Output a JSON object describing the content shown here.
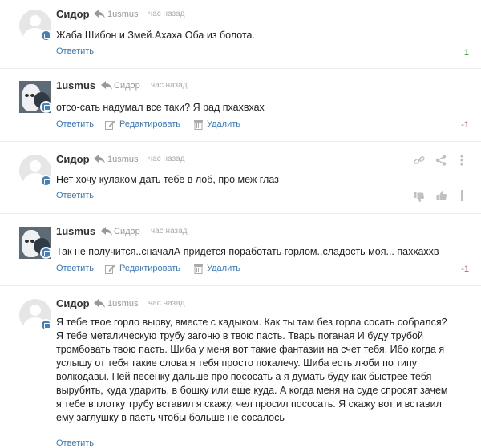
{
  "comments": [
    {
      "author": "Сидор",
      "reply_to": "1usmus",
      "time": "час назад",
      "text": "Жаба Шибон и Змей.Ахаха Оба из болота.",
      "reply_label": "Ответить",
      "rating": "1",
      "avatar": "default-avatar"
    },
    {
      "author": "1usmus",
      "reply_to": "Сидор",
      "time": "час назад",
      "text": "отсо-сать надумал все таки? Я рад пхахвхах",
      "reply_label": "Ответить",
      "edit_label": "Редактировать",
      "delete_label": "Удалить",
      "rating": "-1",
      "avatar": "photo-avatar"
    },
    {
      "author": "Сидор",
      "reply_to": "1usmus",
      "time": "час назад",
      "text": "Нет хочу кулаком дать тебе в лоб, про меж глаз",
      "reply_label": "Ответить",
      "avatar": "default-avatar"
    },
    {
      "author": "1usmus",
      "reply_to": "Сидор",
      "time": "час назад",
      "text": "Так не получится..сначалА придется поработать горлом..сладость моя... паххаххв",
      "reply_label": "Ответить",
      "edit_label": "Редактировать",
      "delete_label": "Удалить",
      "rating": "-1",
      "avatar": "photo-avatar"
    },
    {
      "author": "Сидор",
      "reply_to": "1usmus",
      "time": "час назад",
      "lines": [
        "Я тебе твое горло вырву, вместе с кадыком. Как ты там без горла сосать собрался?",
        "Я тебе металическую трубу загоню в твою пасть. Тварь поганая И буду трубой",
        "тромбовать твою пасть. Шиба у меня вот такие фантазии на счет тебя. Ибо когда я",
        "услышу от тебя такие слова я тебя просто покалечу. Шиба есть люби по типу",
        "волкодавы. Пей песенку дальше про пососать а я думать буду как быстрее тебя",
        "вырубить, куда ударить, в бошку или еще куда. А когда меня на суде спросят зачем",
        "я тебе в глотку трубу вставил я скажу, чел просил пососать. Я скажу вот и вставил",
        "ему заглушку в пасть чтобы больше не сосалось"
      ],
      "reply_label": "Ответить",
      "avatar": "default-avatar"
    }
  ],
  "colors": {
    "link": "#3b7abf",
    "positive": "#2ca02c",
    "negative": "#d9534f",
    "badge": "#4a7fb5"
  }
}
